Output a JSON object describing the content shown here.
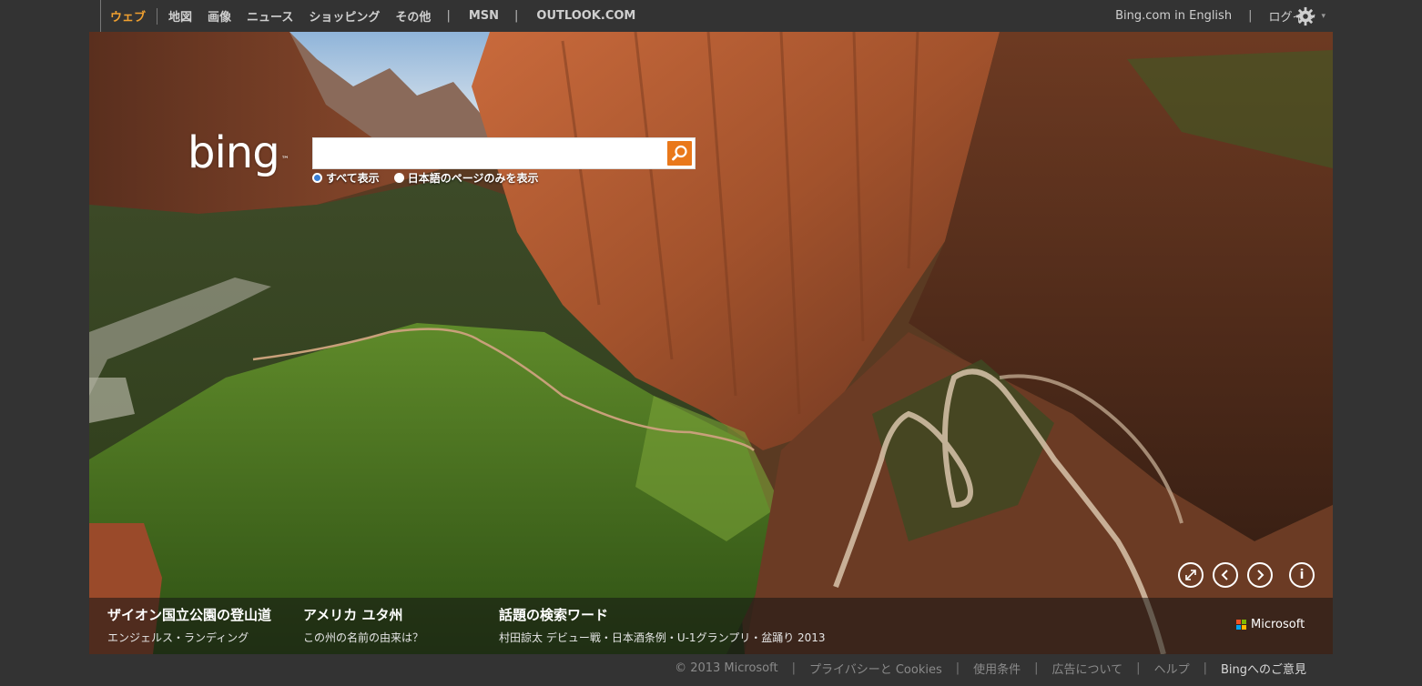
{
  "nav": {
    "items": [
      {
        "label": "ウェブ",
        "active": true
      },
      {
        "label": "地図"
      },
      {
        "label": "画像"
      },
      {
        "label": "ニュース"
      },
      {
        "label": "ショッピング"
      },
      {
        "label": "その他"
      }
    ],
    "msn": "MSN",
    "outlook": "OUTLOOK.COM",
    "separator": "|"
  },
  "topright": {
    "english": "Bing.com in English",
    "login": "ログイン",
    "caret": "▾",
    "separator": "|"
  },
  "search": {
    "logo": "bing",
    "logo_tm": "™",
    "value": "",
    "placeholder": "",
    "scope_all": "すべて表示",
    "scope_ja": "日本語のページのみを表示",
    "selected_scope": "すべて表示"
  },
  "image_controls": {
    "expand": "⤢",
    "prev": "‹",
    "next": "›",
    "info": "i"
  },
  "captions": [
    {
      "title": "ザイオン国立公園の登山道",
      "sub": "エンジェルス・ランディング"
    },
    {
      "title": "アメリカ ユタ州",
      "sub": "この州の名前の由来は？"
    },
    {
      "title": "話題の検索ワード",
      "sub": "村田諒太 デビュー戦・日本酒条例・U-1グランプリ・盆踊り 2013"
    }
  ],
  "microsoft": {
    "label": "Microsoft",
    "colors": [
      "#f25022",
      "#7fba00",
      "#00a4ef",
      "#ffb900"
    ]
  },
  "footer": {
    "copyright": "© 2013 Microsoft",
    "privacy": "プライバシーと Cookies",
    "terms": "使用条件",
    "ads": "広告について",
    "help": "ヘルプ",
    "feedback": "Bingへのご意見",
    "separator": "|"
  },
  "colors": {
    "accent": "#f0a030",
    "search_button": "#e9781b",
    "topbar": "#333333"
  }
}
